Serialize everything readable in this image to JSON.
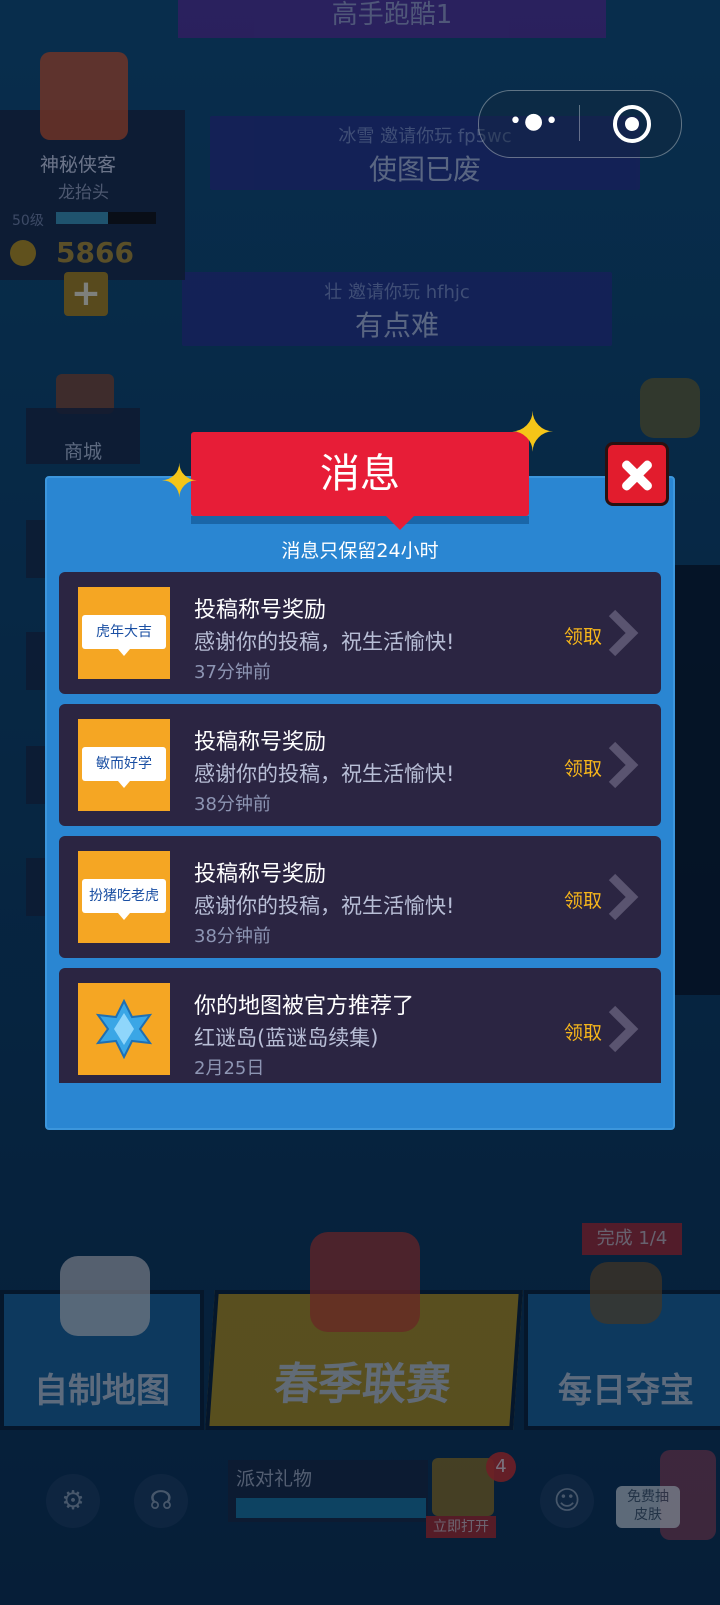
{
  "background": {
    "top_banner": "高手跑酷1",
    "invite_banners": [
      {
        "sub": "冰雪 邀请你玩 fp5wc",
        "main": "使图已废"
      },
      {
        "sub": "壮 邀请你玩 hfhjc",
        "main": "有点难"
      }
    ],
    "profile": {
      "name": "神秘侠客",
      "title": "龙抬头",
      "level": "50级",
      "coins": "5866",
      "plus": "+"
    },
    "shop_label": "商城",
    "bottom": {
      "custom_map": "自制地图",
      "spring_league": "春季联赛",
      "daily_treasure": "每日夺宝",
      "done_badge": "完成 1/4",
      "party_gift": "派对礼物",
      "gift_count": "4",
      "open_now": "立即打开",
      "free_skin": "免费抽\n皮肤"
    }
  },
  "wechat_capsule": {
    "more_icon": "more-dots-icon",
    "close_icon": "target-circle-icon"
  },
  "modal": {
    "title": "消息",
    "notice": "消息只保留24小时",
    "colors": {
      "panel": "#2a86d2",
      "header": "#e71d37",
      "item_bg": "#2b2542",
      "thumb": "#f5a623",
      "claim": "#f5b51b"
    },
    "messages": [
      {
        "thumb_text": "虎年大吉",
        "title": "投稿称号奖励",
        "desc": "感谢你的投稿，祝生活愉快!",
        "time": "37分钟前",
        "action": "领取"
      },
      {
        "thumb_text": "敏而好学",
        "title": "投稿称号奖励",
        "desc": "感谢你的投稿，祝生活愉快!",
        "time": "38分钟前",
        "action": "领取"
      },
      {
        "thumb_text": "扮猪吃老虎",
        "title": "投稿称号奖励",
        "desc": "感谢你的投稿，祝生活愉快!",
        "time": "38分钟前",
        "action": "领取"
      },
      {
        "thumb_icon": "blue-snowflake-gem-icon",
        "title": "你的地图被官方推荐了",
        "desc": "红谜岛(蓝谜岛续集)",
        "time": "2月25日",
        "action": "领取"
      }
    ]
  }
}
